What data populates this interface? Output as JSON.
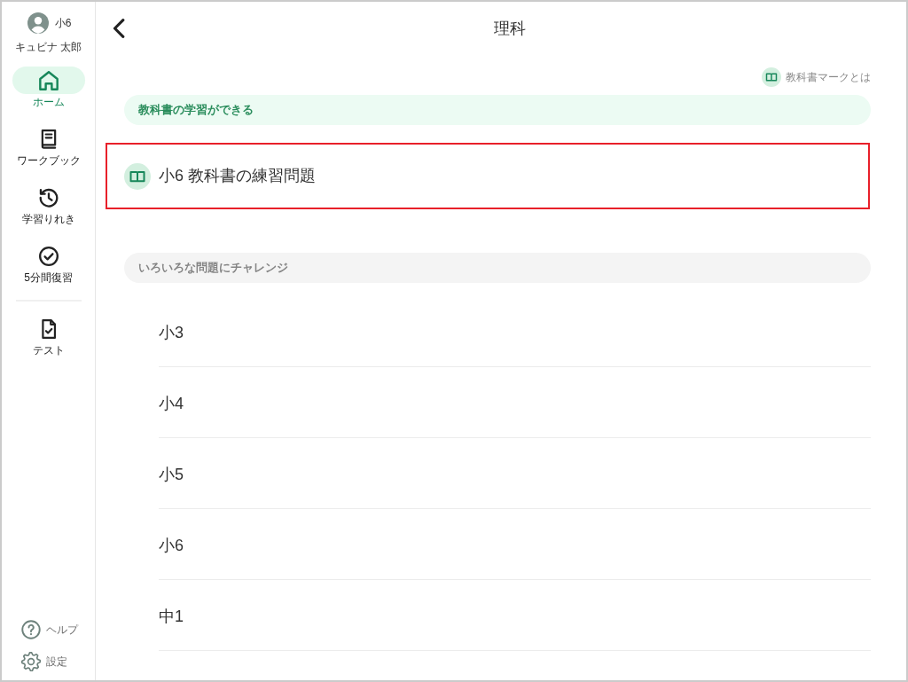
{
  "sidebar": {
    "user": {
      "grade": "小6",
      "name": "キュビナ 太郎"
    },
    "nav_groups": [
      [
        {
          "kind": "home",
          "label": "ホーム",
          "selected": true
        },
        {
          "kind": "workbook",
          "label": "ワークブック",
          "selected": false
        },
        {
          "kind": "history",
          "label": "学習りれき",
          "selected": false
        },
        {
          "kind": "review",
          "label": "5分間復習",
          "selected": false
        }
      ],
      [
        {
          "kind": "test",
          "label": "テスト",
          "selected": false
        }
      ]
    ],
    "footer": [
      {
        "kind": "help",
        "label": "ヘルプ"
      },
      {
        "kind": "settings",
        "label": "設定"
      }
    ]
  },
  "header": {
    "title": "理科"
  },
  "textbook_mark_link": "教科書マークとは",
  "sections": [
    {
      "kind": "textbook",
      "heading": "教科書の学習ができる",
      "items": [
        {
          "label": "小6 教科書の練習問題",
          "highlighted": true
        }
      ]
    },
    {
      "kind": "grades",
      "heading": "いろいろな問題にチャレンジ",
      "items": [
        {
          "label": "小3"
        },
        {
          "label": "小4"
        },
        {
          "label": "小5"
        },
        {
          "label": "小6"
        },
        {
          "label": "中1"
        }
      ]
    }
  ]
}
